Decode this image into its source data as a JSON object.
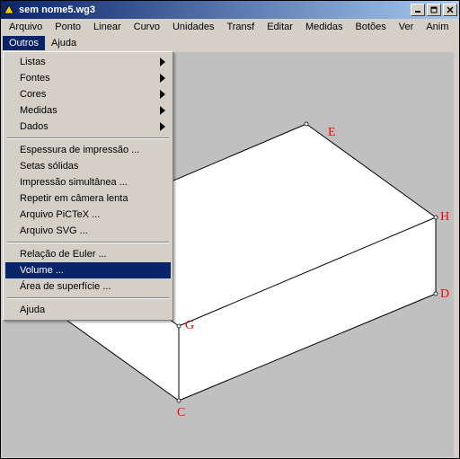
{
  "window": {
    "title": "sem nome5.wg3"
  },
  "menubar_top": [
    "Arquivo",
    "Ponto",
    "Linear",
    "Curvo",
    "Unidades",
    "Transf",
    "Editar",
    "Medidas",
    "Botões",
    "Ver",
    "Anim"
  ],
  "menubar_second": [
    "Outros",
    "Ajuda"
  ],
  "menubar_second_open_index": 0,
  "dropdown": {
    "items": [
      {
        "label": "Listas",
        "submenu": true
      },
      {
        "label": "Fontes",
        "submenu": true
      },
      {
        "label": "Cores",
        "submenu": true
      },
      {
        "label": "Medidas",
        "submenu": true
      },
      {
        "label": "Dados",
        "submenu": true
      },
      {
        "sep": true
      },
      {
        "label": "Espessura de impressão ..."
      },
      {
        "label": "Setas sólidas"
      },
      {
        "label": "Impressão simultânea ..."
      },
      {
        "label": "Repetir em câmera lenta"
      },
      {
        "label": "Arquivo PiCTeX ..."
      },
      {
        "label": "Arquivo SVG ..."
      },
      {
        "sep": true
      },
      {
        "label": "Relação de Euler ..."
      },
      {
        "label": "Volume ...",
        "highlight": true
      },
      {
        "label": "Área de superfície ..."
      },
      {
        "sep": true
      },
      {
        "label": "Ajuda"
      }
    ]
  },
  "labels": {
    "E": "E",
    "H": "H",
    "D": "D",
    "G": "G",
    "C": "C"
  }
}
